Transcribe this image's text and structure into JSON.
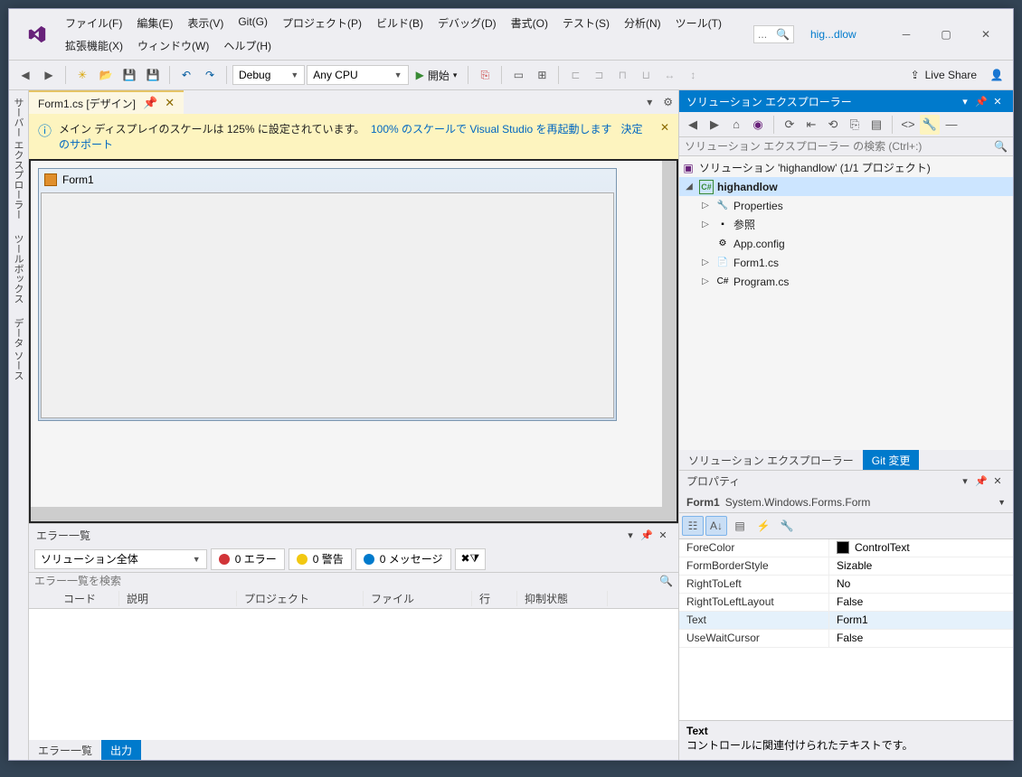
{
  "menus": [
    "ファイル(F)",
    "編集(E)",
    "表示(V)",
    "Git(G)",
    "プロジェクト(P)",
    "ビルド(B)",
    "デバッグ(D)",
    "書式(O)",
    "テスト(S)",
    "分析(N)",
    "ツール(T)",
    "拡張機能(X)",
    "ウィンドウ(W)",
    "ヘルプ(H)"
  ],
  "quicklaunch_placeholder": "...",
  "solution_short": "hig...dlow",
  "toolbar": {
    "config": "Debug",
    "platform": "Any CPU",
    "start": "開始",
    "liveshare": "Live Share"
  },
  "doc_tab": "Form1.cs [デザイン]",
  "infobar": {
    "msg": "メイン ディスプレイのスケールは 125% に設定されています。",
    "link1": "100% のスケールで Visual Studio を再起動します",
    "link2": "決定のサポート"
  },
  "form_title": "Form1",
  "sidetabs": [
    "サーバー エクスプローラー",
    "ツールボックス",
    "データ ソース"
  ],
  "errorlist": {
    "title": "エラー一覧",
    "scope": "ソリューション全体",
    "errors_label": "0 エラー",
    "warnings_label": "0 警告",
    "messages_label": "0 メッセージ",
    "search_placeholder": "エラー一覧を検索",
    "cols": [
      "",
      "コード",
      "説明",
      "プロジェクト",
      "ファイル",
      "行",
      "抑制状態"
    ]
  },
  "bottom_tabs": {
    "errorlist": "エラー一覧",
    "output": "出力"
  },
  "sln": {
    "title": "ソリューション エクスプローラー",
    "search_placeholder": "ソリューション エクスプローラー の検索 (Ctrl+:)",
    "root": "ソリューション 'highandlow' (1/1 プロジェクト)",
    "project": "highandlow",
    "items": [
      "Properties",
      "参照",
      "App.config",
      "Form1.cs",
      "Program.cs"
    ],
    "tabs": {
      "sln": "ソリューション エクスプローラー",
      "git": "Git 変更"
    }
  },
  "props": {
    "title": "プロパティ",
    "object_name": "Form1",
    "object_type": "System.Windows.Forms.Form",
    "rows": [
      {
        "n": "ForeColor",
        "v": "ControlText",
        "swatch": true
      },
      {
        "n": "FormBorderStyle",
        "v": "Sizable"
      },
      {
        "n": "RightToLeft",
        "v": "No"
      },
      {
        "n": "RightToLeftLayout",
        "v": "False"
      },
      {
        "n": "Text",
        "v": "Form1",
        "sel": true
      },
      {
        "n": "UseWaitCursor",
        "v": "False"
      }
    ],
    "desc_title": "Text",
    "desc_body": "コントロールに関連付けられたテキストです。"
  }
}
